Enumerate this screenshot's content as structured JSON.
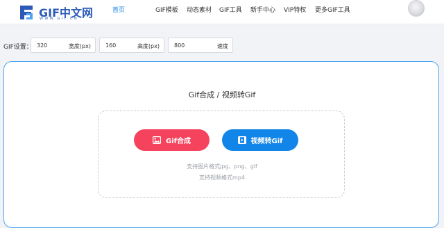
{
  "header": {
    "logo_text": "GIF中文网",
    "logo_sub": "WWW.GIF.CN",
    "nav": [
      {
        "label": "首页",
        "active": true
      },
      {
        "label": "GIF模板",
        "active": false
      },
      {
        "label": "动态素材",
        "active": false
      },
      {
        "label": "GIF工具",
        "active": false
      },
      {
        "label": "新手中心",
        "active": false
      },
      {
        "label": "VIP特权",
        "active": false
      },
      {
        "label": "更多GIF工具",
        "active": false
      }
    ]
  },
  "settings": {
    "label": "GIF设置：",
    "width": {
      "value": "320",
      "unit": "宽度(px)"
    },
    "height": {
      "value": "160",
      "unit": "高度(px)"
    },
    "speed": {
      "value": "800",
      "unit": "速度"
    }
  },
  "panel": {
    "title": "Gif合成 / 视频转Gif",
    "button_gif": "Gif合成",
    "button_video": "视频转Gif",
    "hint_image": "支持图片格式jpg、png、gif",
    "hint_video": "支持视频格式mp4"
  },
  "colors": {
    "accent_blue": "#1285e8",
    "accent_red": "#f5435d",
    "nav_active": "#1f88e5",
    "logo": "#2d5ab8"
  },
  "icons": [
    "logo-mark-icon",
    "image-icon",
    "video-icon",
    "avatar"
  ]
}
